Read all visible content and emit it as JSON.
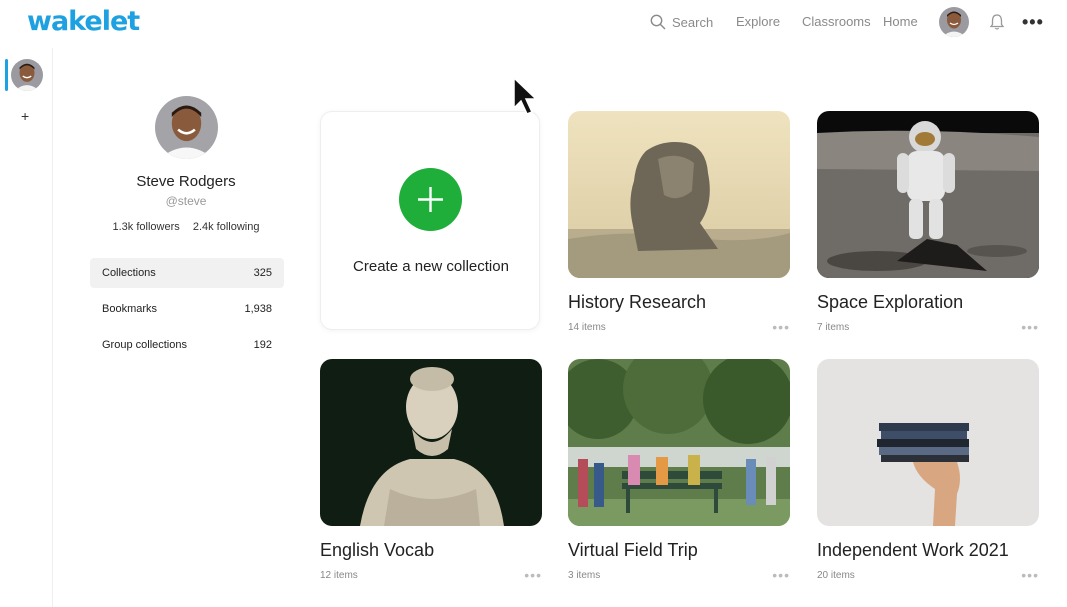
{
  "brand": {
    "logo_text": "wakelet",
    "accent_color": "#1ea1e0",
    "create_color": "#1fae3a"
  },
  "nav": {
    "search_label": "Search",
    "explore_label": "Explore",
    "classrooms_label": "Classrooms",
    "home_label": "Home",
    "bell_icon": "bell-icon",
    "more_icon": "more-horizontal-icon"
  },
  "rail": {
    "add_label": "+"
  },
  "profile": {
    "name": "Steve Rodgers",
    "handle": "@steve",
    "followers": "1.3k followers",
    "following": "2.4k following"
  },
  "side_menu": [
    {
      "label": "Collections",
      "count": "325",
      "active": true
    },
    {
      "label": "Bookmarks",
      "count": "1,938",
      "active": false
    },
    {
      "label": "Group collections",
      "count": "192",
      "active": false
    }
  ],
  "create": {
    "label": "Create a new collection"
  },
  "collections": [
    {
      "title": "History Research",
      "items": "14 items"
    },
    {
      "title": "Space Exploration",
      "items": "7 items"
    },
    {
      "title": "English Vocab",
      "items": "12 items"
    },
    {
      "title": "Virtual Field Trip",
      "items": "3 items"
    },
    {
      "title": "Independent Work 2021",
      "items": "20 items"
    }
  ],
  "card_more_label": "•••",
  "top_more_label": "•••"
}
